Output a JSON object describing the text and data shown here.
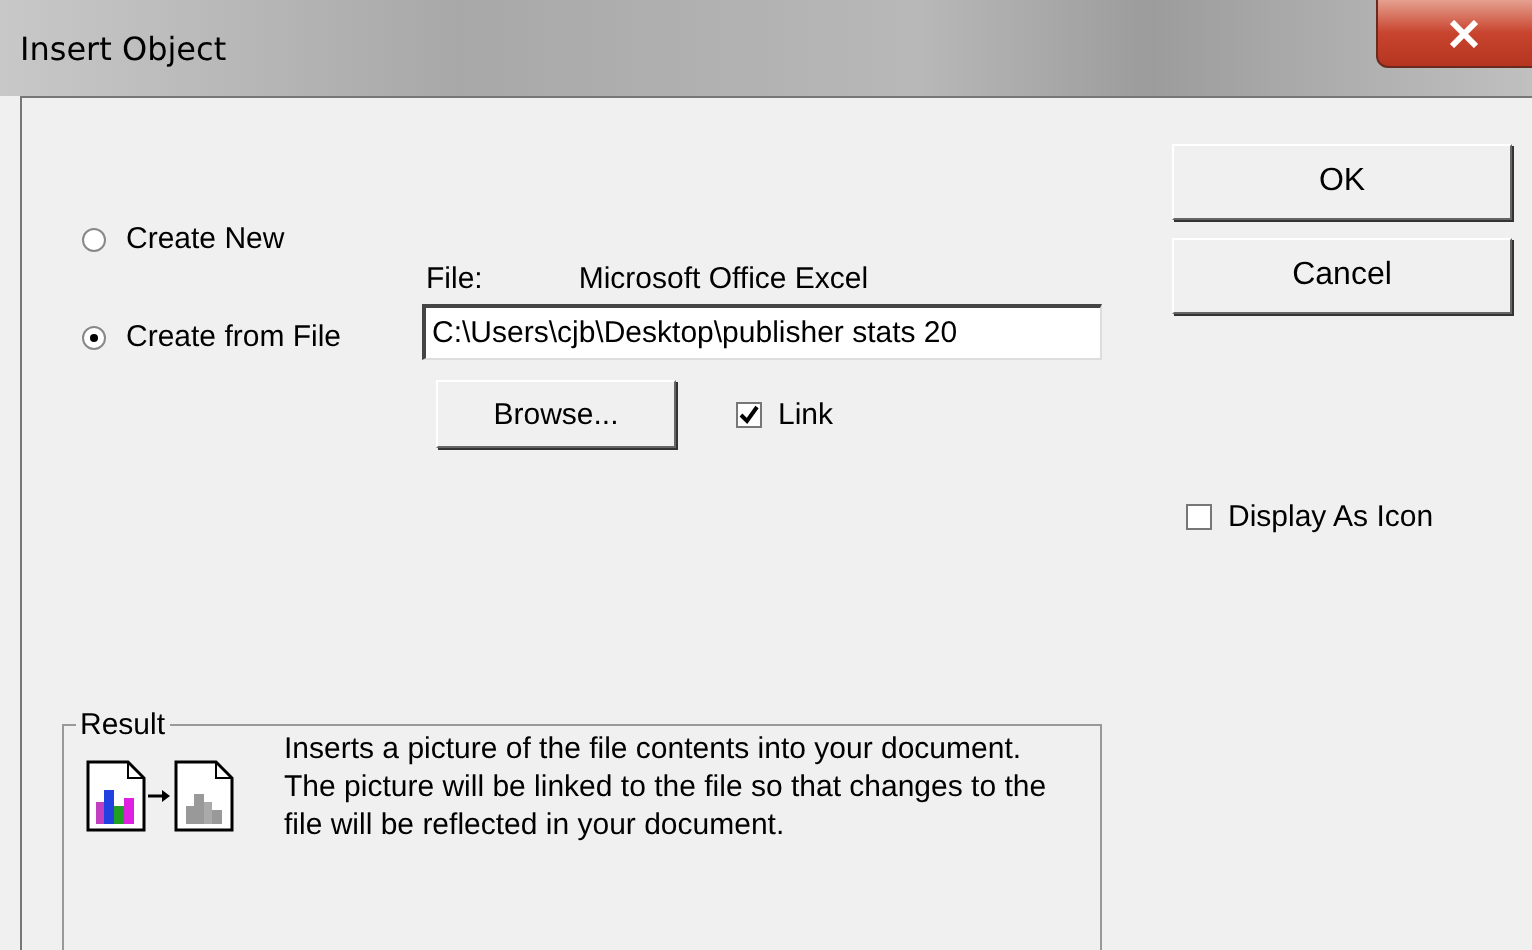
{
  "window": {
    "title": "Insert Object"
  },
  "options": [
    {
      "label": "Create New",
      "selected": false
    },
    {
      "label": "Create from File",
      "selected": true
    }
  ],
  "file": {
    "label": "File:",
    "type_name": "Microsoft Office Excel",
    "value": "C:\\Users\\cjb\\Desktop\\publisher stats 20"
  },
  "browse_button": "Browse...",
  "link": {
    "label": "Link",
    "checked": true
  },
  "buttons": [
    "OK",
    "Cancel"
  ],
  "display_as_icon": {
    "label": "Display As Icon",
    "checked": false
  },
  "result": {
    "title": "Result",
    "text": "Inserts a picture of the file contents into your document.  The picture will be linked to the file so that changes to the file will be reflected in your document."
  }
}
